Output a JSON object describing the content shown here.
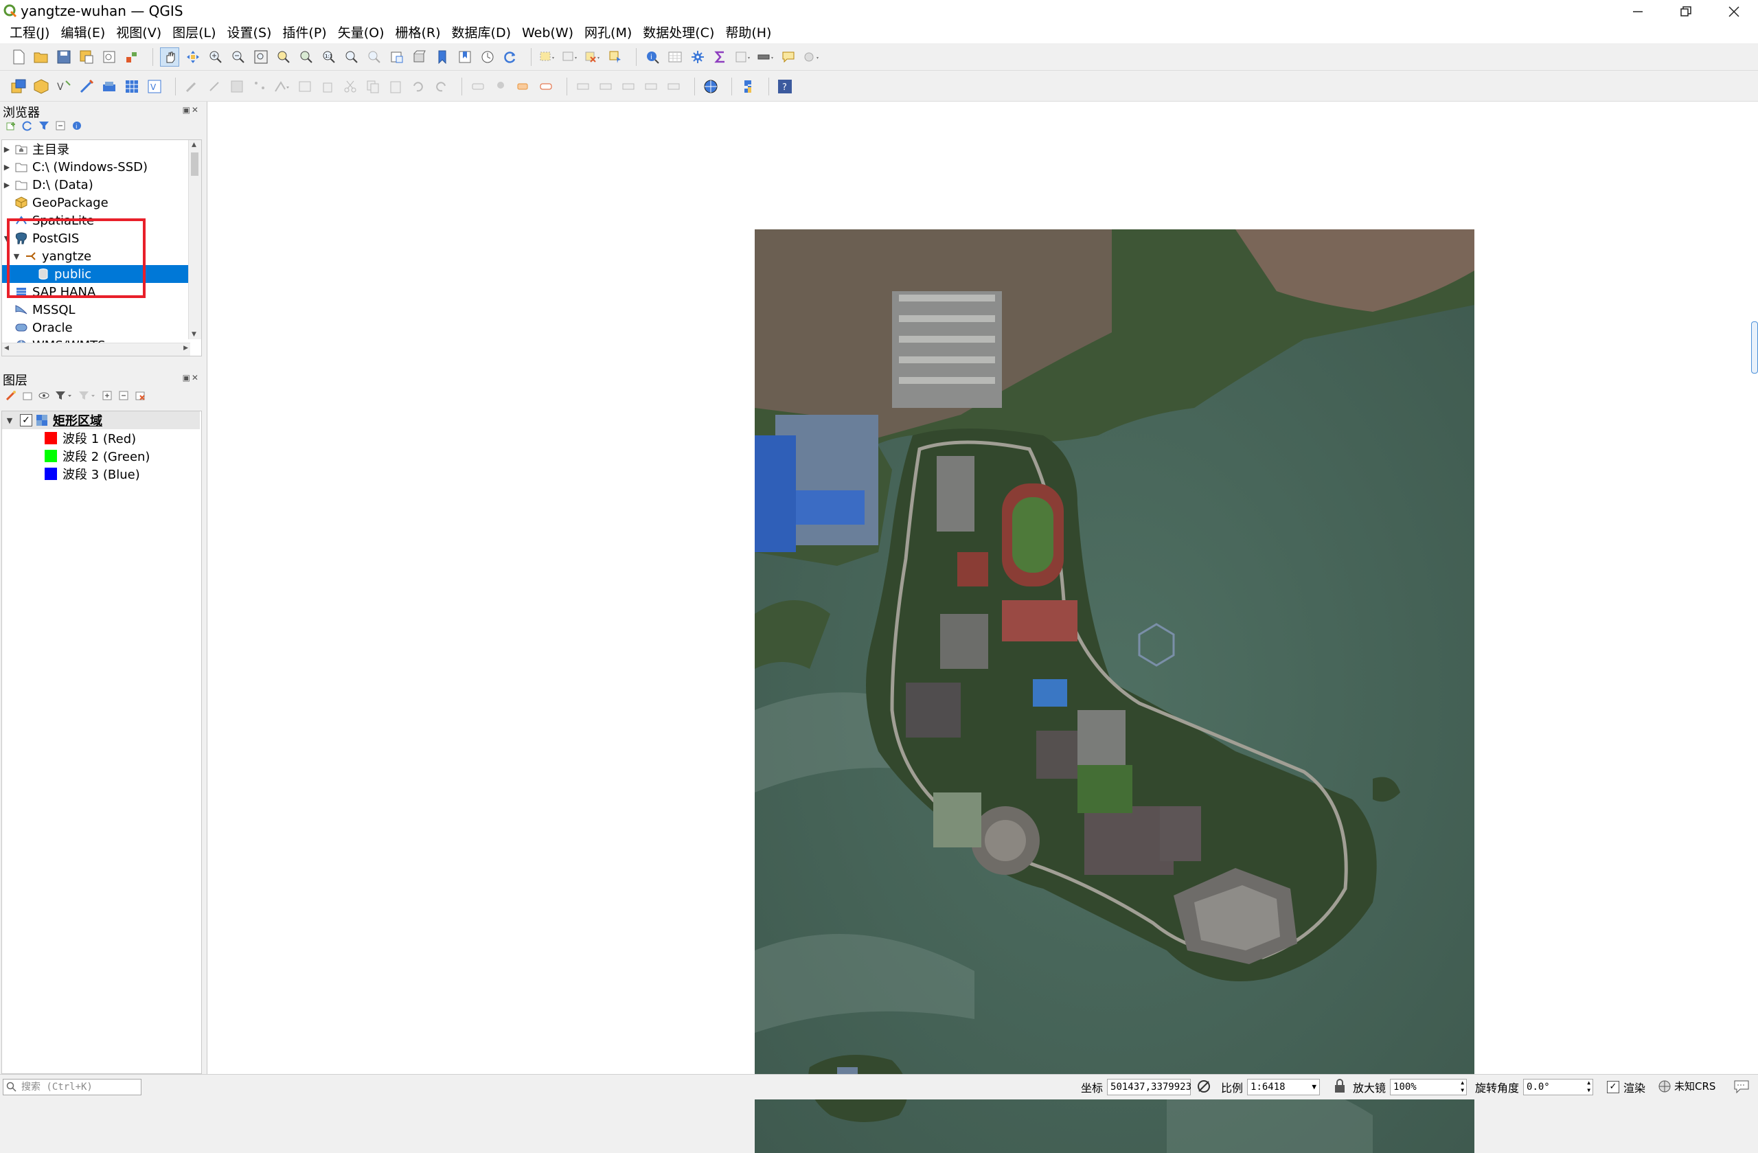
{
  "window": {
    "title": "yangtze-wuhan — QGIS",
    "controls": [
      "minimize",
      "restore",
      "close"
    ]
  },
  "menu": [
    "工程(J)",
    "编辑(E)",
    "视图(V)",
    "图层(L)",
    "设置(S)",
    "插件(P)",
    "矢量(O)",
    "栅格(R)",
    "数据库(D)",
    "Web(W)",
    "网孔(M)",
    "数据处理(C)",
    "帮助(H)"
  ],
  "browser_panel": {
    "title": "浏览器",
    "items": [
      {
        "label": "主目录",
        "icon": "home-folder-icon",
        "expander": "collapsed"
      },
      {
        "label": "C:\\ (Windows-SSD)",
        "icon": "folder-icon",
        "expander": "collapsed"
      },
      {
        "label": "D:\\ (Data)",
        "icon": "folder-icon",
        "expander": "collapsed"
      },
      {
        "label": "GeoPackage",
        "icon": "geopackage-icon",
        "expander": "none"
      },
      {
        "label": "SpatiaLite",
        "icon": "spatialite-icon",
        "expander": "none"
      },
      {
        "label": "PostGIS",
        "icon": "postgis-elephant-icon",
        "expander": "expanded"
      },
      {
        "label": "yangtze",
        "icon": "connection-icon",
        "expander": "expanded"
      },
      {
        "label": "public",
        "icon": "schema-icon",
        "expander": "none",
        "selected": true
      },
      {
        "label": "SAP HANA",
        "icon": "hana-icon",
        "expander": "none"
      },
      {
        "label": "MSSQL",
        "icon": "mssql-icon",
        "expander": "none"
      },
      {
        "label": "Oracle",
        "icon": "oracle-icon",
        "expander": "none"
      },
      {
        "label": "WMS/WMTS",
        "icon": "wms-globe-icon",
        "expander": "none"
      }
    ]
  },
  "layers_panel": {
    "title": "图层",
    "layer": {
      "name": "矩形区域",
      "checked": true
    },
    "bands": [
      {
        "label": "波段 1 (Red)",
        "color": "#ff0000"
      },
      {
        "label": "波段 2 (Green)",
        "color": "#00ff00"
      },
      {
        "label": "波段 3 (Blue)",
        "color": "#0000ff"
      }
    ]
  },
  "statusbar": {
    "search_placeholder": "搜索 (Ctrl+K)",
    "coordinate_label": "坐标",
    "coordinate_value": "501437,3379923",
    "scale_label": "比例",
    "scale_value": "1:6418",
    "magnifier_label": "放大镜",
    "magnifier_value": "100%",
    "rotation_label": "旋转角度",
    "rotation_value": "0.0°",
    "render_label": "渲染",
    "crs_label": "未知CRS"
  },
  "colors": {
    "selection": "#0078d7",
    "highlight_box": "#e8202a",
    "water": "#4a6a5c",
    "vegetation": "#2f4a2a"
  }
}
